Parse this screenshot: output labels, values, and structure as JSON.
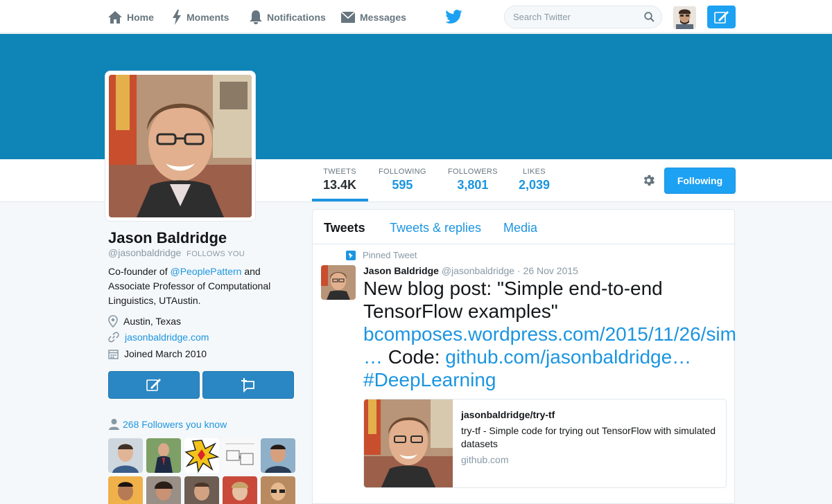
{
  "nav": {
    "home": "Home",
    "moments": "Moments",
    "notifications": "Notifications",
    "messages": "Messages",
    "search_placeholder": "Search Twitter"
  },
  "colors": {
    "accent": "#1da1f2",
    "banner": "#0f84b7",
    "link": "#1b95e0"
  },
  "profile": {
    "name": "Jason Baldridge",
    "handle": "@jasonbaldridge",
    "follows_you": "FOLLOWS YOU",
    "bio_prefix": "Co-founder of ",
    "bio_mention": "@PeoplePattern",
    "bio_suffix": " and Associate Professor of Computational Linguistics, UTAustin.",
    "location": "Austin, Texas",
    "website": "jasonbaldridge.com",
    "joined": "Joined March 2010",
    "followers_you_know": "268 Followers you know"
  },
  "stats": [
    {
      "label": "TWEETS",
      "value": "13.4K"
    },
    {
      "label": "FOLLOWING",
      "value": "595"
    },
    {
      "label": "FOLLOWERS",
      "value": "3,801"
    },
    {
      "label": "LIKES",
      "value": "2,039"
    }
  ],
  "follow_button": "Following",
  "tabs": [
    "Tweets",
    "Tweets & replies",
    "Media"
  ],
  "tweet": {
    "pinned_label": "Pinned Tweet",
    "author": "Jason Baldridge",
    "handle": "@jasonbaldridge",
    "date": "· 26 Nov 2015",
    "text_start": "New blog post: \"Simple end-to-end TensorFlow examples\" ",
    "link1": "bcomposes.wordpress.com/2015/11/26/sim …",
    "text_mid": " Code: ",
    "link2": "github.com/jasonbaldridge…",
    "hashtag": "#DeepLearning",
    "card": {
      "title": "jasonbaldridge/try-tf",
      "description": "try-tf - Simple code for trying out TensorFlow with simulated datasets",
      "url": "github.com"
    }
  }
}
